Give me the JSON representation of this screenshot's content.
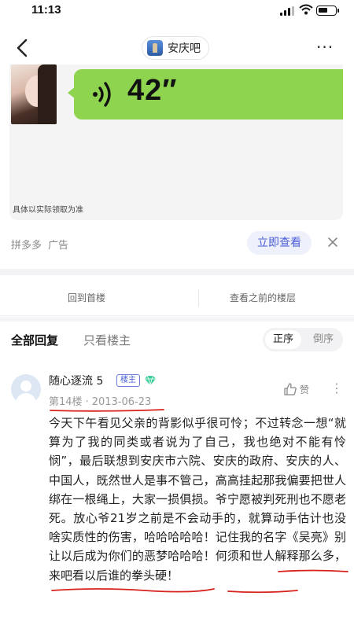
{
  "status_bar": {
    "time": "11:13"
  },
  "nav": {
    "forum_name": "安庆吧"
  },
  "ad": {
    "voice_duration": "42″",
    "disclaimer": "具体以实际领取为准",
    "brand": "拼多多",
    "ad_label": "广告",
    "cta": "立即查看"
  },
  "floor_nav": {
    "back_to_first": "回到首楼",
    "view_previous": "查看之前的楼层"
  },
  "reply_tabs": {
    "all": "全部回复",
    "op_only": "只看楼主",
    "sort_asc": "正序",
    "sort_desc": "倒序"
  },
  "post": {
    "username": "随心逐流 5",
    "op_badge": "楼主",
    "floor": "第14楼",
    "dot": "·",
    "date": "2013-06-23",
    "like_label": "赞",
    "body": "今天下午看见父亲的背影似乎很可怜；不过转念一想“就算为了我的同类或者说为了自己，我也绝对不能有怜悯”，最后联想到安庆市六院、安庆的政府、安庆的人、中国人，既然世人是事不管己，高高挂起那我偏要把世人绑在一根绳上，大家一损俱损。爷宁愿被判死刑也不愿老死。放心爷21岁之前是不会动手的，就算动手估计也没啥实质性的伤害，哈哈哈哈哈！记住我的名字《吴亮》别让以后成为你们的恶梦哈哈哈！何须和世人解释那么多，来吧看以后谁的拳头硬！"
  },
  "colors": {
    "accent": "#4a5dd8",
    "voice_green": "#8fd44f",
    "annotation_red": "#d8221c"
  }
}
